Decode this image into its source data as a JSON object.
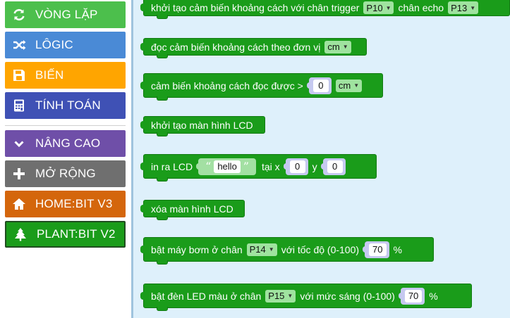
{
  "sidebar": {
    "categories": [
      {
        "label": "VÒNG LẶP",
        "icon": "loop-icon",
        "color": "#4cbf4c"
      },
      {
        "label": "LÔGIC",
        "icon": "shuffle-icon",
        "color": "#4a8ad6"
      },
      {
        "label": "BIẾN",
        "icon": "save-icon",
        "color": "#ffa500"
      },
      {
        "label": "TÍNH TOÁN",
        "icon": "calculator-icon",
        "color": "#3f51b5"
      },
      {
        "label": "NÂNG CAO",
        "icon": "chevron-down-icon",
        "color": "#6f4fa8"
      },
      {
        "label": "MỞ RỘNG",
        "icon": "plus-icon",
        "color": "#6f6f6f"
      },
      {
        "label": "HOME:BIT V3",
        "icon": "home-icon",
        "color": "#d4660c"
      },
      {
        "label": "PLANT:BIT V2",
        "icon": "tree-icon",
        "color": "#1a9c1a"
      }
    ]
  },
  "blocks": {
    "init_sensor": {
      "text1": "khởi tạo cảm biến khoảng cách với chân trigger",
      "trigger": "P10",
      "text2": "chân echo",
      "echo": "P13"
    },
    "read_sensor": {
      "text": "đọc cảm biến khoảng cách theo đơn vị",
      "unit": "cm"
    },
    "compare_sensor": {
      "text": "cảm biến khoảng cách đọc được >",
      "value": "0",
      "unit": "cm"
    },
    "init_lcd": {
      "text": "khởi tạo màn hình LCD"
    },
    "print_lcd": {
      "text1": "in ra LCD",
      "str": "hello",
      "quote_open": "“",
      "quote_close": "”",
      "text2": "tại x",
      "x": "0",
      "text3": "y",
      "y": "0"
    },
    "clear_lcd": {
      "text": "xóa màn hình LCD"
    },
    "pump": {
      "text1": "bật máy bơm ở chân",
      "pin": "P14",
      "text2": "với tốc độ (0-100)",
      "speed": "70",
      "unit": "%"
    },
    "led": {
      "text1": "bật đèn LED màu ở chân",
      "pin": "P15",
      "text2": "với mức sáng (0-100)",
      "level": "70",
      "unit": "%"
    }
  }
}
